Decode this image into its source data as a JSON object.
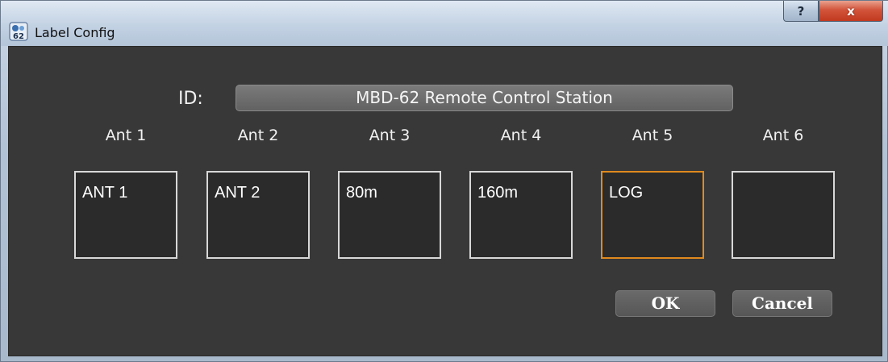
{
  "window": {
    "title": "Label Config",
    "help_label": "?",
    "close_label": "x"
  },
  "form": {
    "id_label": "ID:",
    "id_value": "MBD-62 Remote Control Station"
  },
  "antennas": [
    {
      "label": "Ant 1",
      "value": "ANT 1"
    },
    {
      "label": "Ant 2",
      "value": "ANT 2"
    },
    {
      "label": "Ant 3",
      "value": "80m"
    },
    {
      "label": "Ant 4",
      "value": "160m"
    },
    {
      "label": "Ant 5",
      "value": "LOG"
    },
    {
      "label": "Ant 6",
      "value": ""
    }
  ],
  "buttons": {
    "ok_label": "OK",
    "cancel_label": "Cancel"
  },
  "colors": {
    "focus_border": "#e08a1e",
    "dialog_bg": "#383838"
  }
}
